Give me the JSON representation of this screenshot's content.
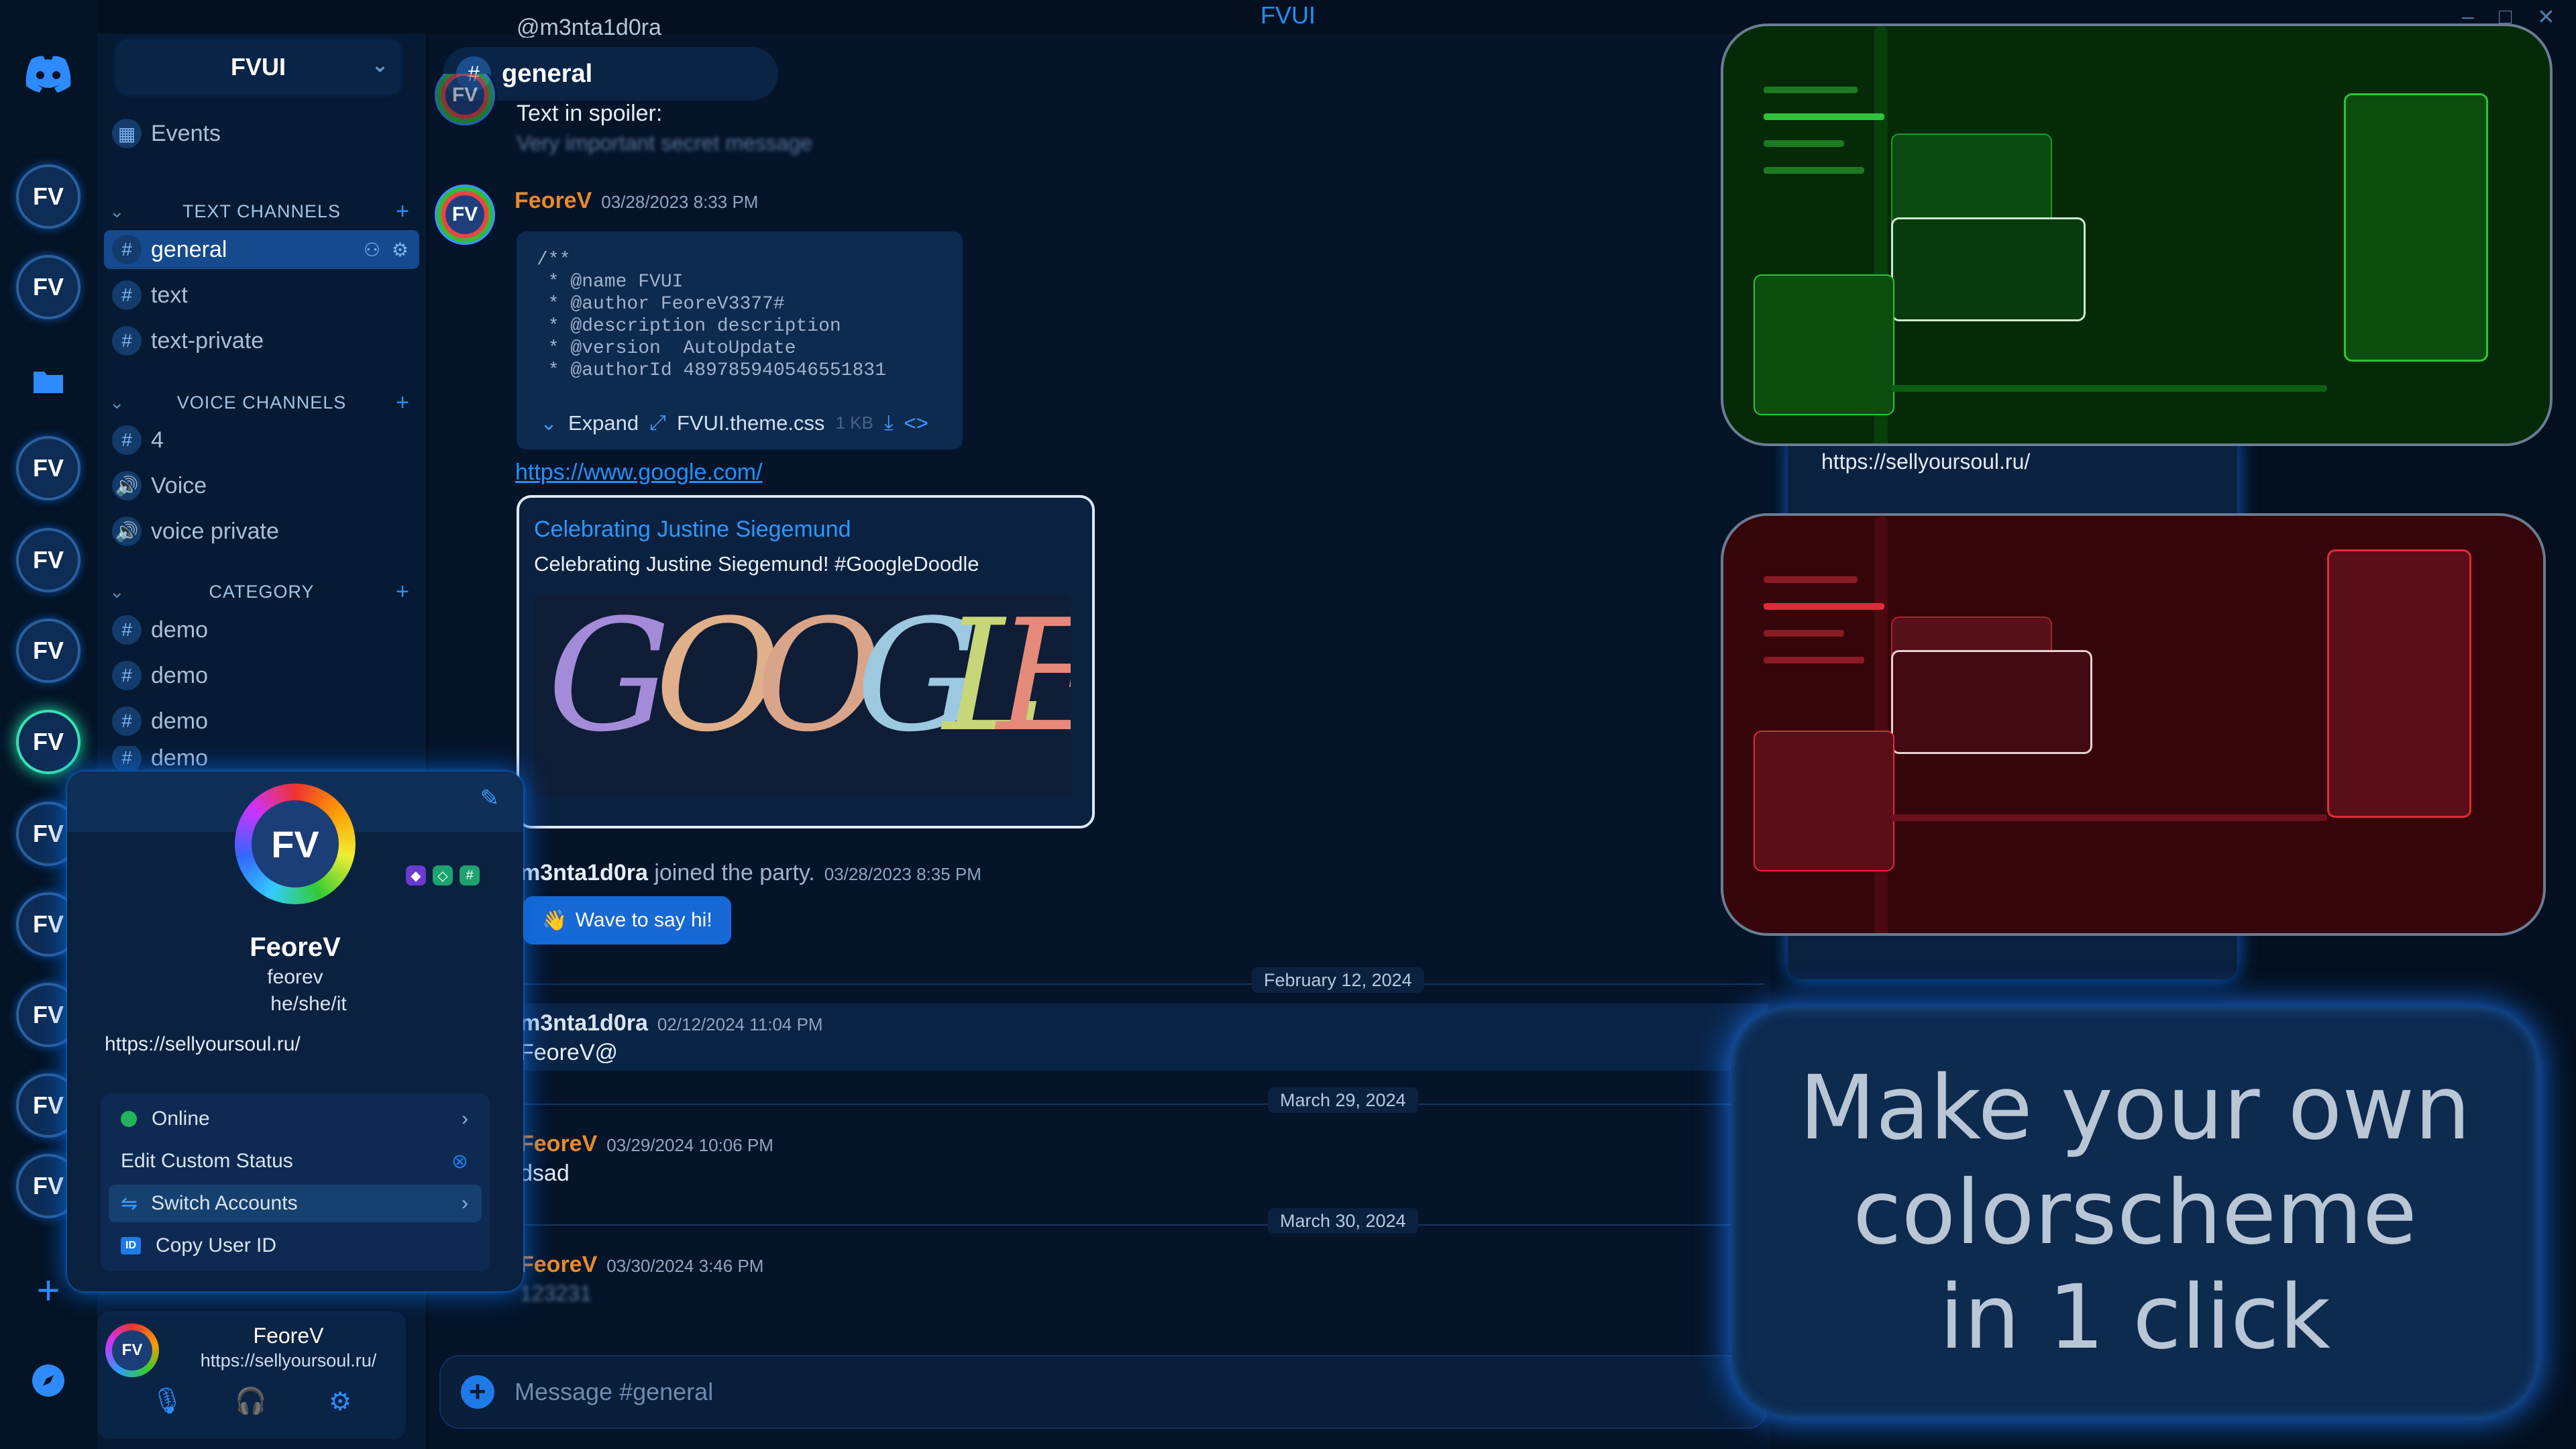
{
  "window": {
    "title": "FVUI",
    "controls": [
      "–",
      "□",
      "✕"
    ]
  },
  "server_rail": {
    "home_icon": "discord-logo-icon",
    "server_label": "FV",
    "add_icon": "plus-icon",
    "explore_icon": "compass-icon",
    "folder_icon": "folder-icon"
  },
  "sidebar": {
    "server_name": "FVUI",
    "events_label": "Events",
    "categories": [
      {
        "name": "TEXT CHANNELS",
        "channels": [
          "general",
          "text",
          "text-private"
        ]
      },
      {
        "name": "VOICE CHANNELS",
        "channels": [
          "4",
          "Voice",
          "voice private"
        ]
      },
      {
        "name": "CATEGORY",
        "channels": [
          "demo",
          "demo",
          "demo",
          "demo"
        ]
      }
    ]
  },
  "chat": {
    "channel": "general",
    "top_cut_user": "@m3nta1d0ra",
    "spoiler_label": "Text in spoiler:",
    "spoiler_text": "Very important secret message",
    "msg1": {
      "author": "FeoreV",
      "time": "03/28/2023 8:33 PM"
    },
    "code": "/**\n * @name FVUI\n * @author FeoreV3377#\n * @description description\n * @version  AutoUpdate\n * @authorId 489785940546551831",
    "code_expand": "Expand",
    "code_file": "FVUI.theme.css",
    "code_size": "1 KB",
    "link": "https://www.google.com/",
    "embed_title": "Celebrating Justine Siegemund",
    "embed_desc": "Celebrating Justine Siegemund! #GoogleDoodle",
    "doodle_text": "GOOGLE",
    "join": {
      "user": "m3nta1d0ra",
      "text": "joined the party.",
      "time": "03/28/2023 8:35 PM"
    },
    "wave_label": "Wave to say hi!",
    "dividers": [
      "February 12, 2024",
      "March 29, 2024",
      "March 30, 2024"
    ],
    "msg2": {
      "author": "m3nta1d0ra",
      "time": "02/12/2024 11:04 PM",
      "text": "FeoreV@"
    },
    "msg3": {
      "author": "FeoreV",
      "time": "03/29/2024 10:06 PM",
      "text": "dsad"
    },
    "msg4": {
      "author": "FeoreV",
      "time": "03/30/2024 3:46 PM",
      "text": "123231"
    },
    "input_placeholder": "Message #general"
  },
  "profile": {
    "display_name": "FeoreV",
    "username": "feorev",
    "pronouns": "he/she/it",
    "url": "https://sellyoursoul.ru/",
    "menu": {
      "status": "Online",
      "custom_status": "Edit Custom Status",
      "switch": "Switch Accounts",
      "copy_id": "Copy User ID",
      "id_badge": "ID"
    }
  },
  "user_panel": {
    "name": "FeoreV",
    "status": "https://sellyoursoul.ru/"
  },
  "preview": {
    "url": "https://sellyoursoul.ru/"
  },
  "promo": {
    "line1": "Make your own",
    "line2": "colorscheme",
    "line3": "in 1 click"
  },
  "colors": {
    "accent": "#1f92ff",
    "green_scheme": "#052a07",
    "red_scheme": "#350509",
    "username_orange": "#e98a2a",
    "background": "#04101f"
  }
}
